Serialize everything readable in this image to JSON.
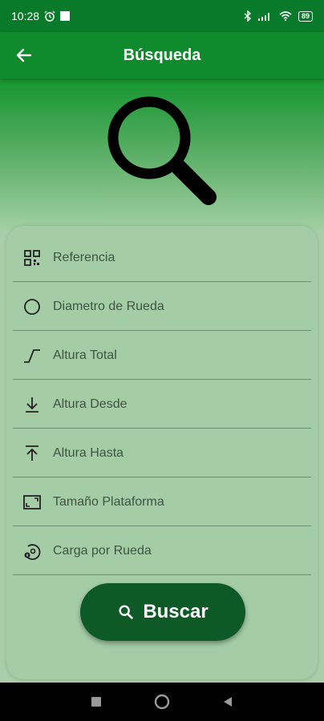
{
  "status_bar": {
    "time": "10:28",
    "battery": "89"
  },
  "app_bar": {
    "title": "Búsqueda"
  },
  "form": {
    "fields": [
      {
        "label": "Referencia",
        "icon": "qr-code-icon"
      },
      {
        "label": "Diametro de Rueda",
        "icon": "circle-icon"
      },
      {
        "label": "Altura Total",
        "icon": "height-curve-icon"
      },
      {
        "label": "Altura Desde",
        "icon": "arrow-down-to-line-icon"
      },
      {
        "label": "Altura Hasta",
        "icon": "arrow-up-from-line-icon"
      },
      {
        "label": "Tamaño Plataforma",
        "icon": "platform-size-icon"
      },
      {
        "label": "Carga por Rueda",
        "icon": "wheel-load-icon"
      }
    ],
    "submit_label": "Buscar"
  },
  "colors": {
    "primary": "#0f8a2d",
    "button": "#0d5a27",
    "card": "#a4cca5",
    "background": "#a9cfa9"
  }
}
